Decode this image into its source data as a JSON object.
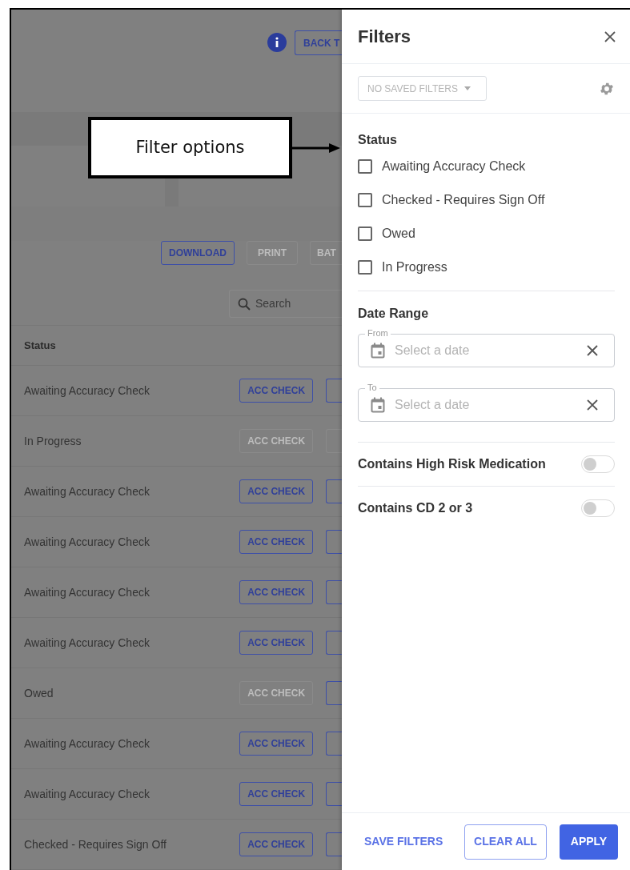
{
  "page": {
    "back_button": "BACK T",
    "toolbar": [
      {
        "label": "DOWNLOAD",
        "disabled": false
      },
      {
        "label": "PRINT",
        "disabled": true
      },
      {
        "label": "BAT",
        "disabled": true
      }
    ],
    "search": {
      "placeholder": "Search"
    },
    "table": {
      "columns": [
        "Status"
      ],
      "rows": [
        {
          "status": "Awaiting Accuracy Check",
          "acc_check": {
            "label": "ACC CHECK",
            "disabled": false
          },
          "second_disabled": false
        },
        {
          "status": "In Progress",
          "acc_check": {
            "label": "ACC CHECK",
            "disabled": true
          },
          "second_disabled": true
        },
        {
          "status": "Awaiting Accuracy Check",
          "acc_check": {
            "label": "ACC CHECK",
            "disabled": false
          },
          "second_disabled": false
        },
        {
          "status": "Awaiting Accuracy Check",
          "acc_check": {
            "label": "ACC CHECK",
            "disabled": false
          },
          "second_disabled": false
        },
        {
          "status": "Awaiting Accuracy Check",
          "acc_check": {
            "label": "ACC CHECK",
            "disabled": false
          },
          "second_disabled": false
        },
        {
          "status": "Awaiting Accuracy Check",
          "acc_check": {
            "label": "ACC CHECK",
            "disabled": false
          },
          "second_disabled": false
        },
        {
          "status": "Owed",
          "acc_check": {
            "label": "ACC CHECK",
            "disabled": true
          },
          "second_disabled": false
        },
        {
          "status": "Awaiting Accuracy Check",
          "acc_check": {
            "label": "ACC CHECK",
            "disabled": false
          },
          "second_disabled": false
        },
        {
          "status": "Awaiting Accuracy Check",
          "acc_check": {
            "label": "ACC CHECK",
            "disabled": false
          },
          "second_disabled": false
        },
        {
          "status": "Checked - Requires Sign Off",
          "acc_check": {
            "label": "ACC CHECK",
            "disabled": false
          },
          "second_disabled": false
        }
      ]
    }
  },
  "callout": {
    "text": "Filter options"
  },
  "filters": {
    "title": "Filters",
    "saved_filters": {
      "label": "NO SAVED FILTERS",
      "disabled": true
    },
    "status": {
      "label": "Status",
      "options": [
        {
          "label": "Awaiting Accuracy Check",
          "checked": false
        },
        {
          "label": "Checked - Requires Sign Off",
          "checked": false
        },
        {
          "label": "Owed",
          "checked": false
        },
        {
          "label": "In Progress",
          "checked": false
        }
      ]
    },
    "date_range": {
      "label": "Date Range",
      "fields": [
        {
          "label": "From",
          "placeholder": "Select a date"
        },
        {
          "label": "To",
          "placeholder": "Select a date"
        }
      ]
    },
    "toggles": [
      {
        "label": "Contains High Risk Medication",
        "on": false
      },
      {
        "label": "Contains CD 2 or 3",
        "on": false
      }
    ],
    "footer": {
      "save": "SAVE FILTERS",
      "clear": "CLEAR ALL",
      "apply": "APPLY"
    }
  }
}
